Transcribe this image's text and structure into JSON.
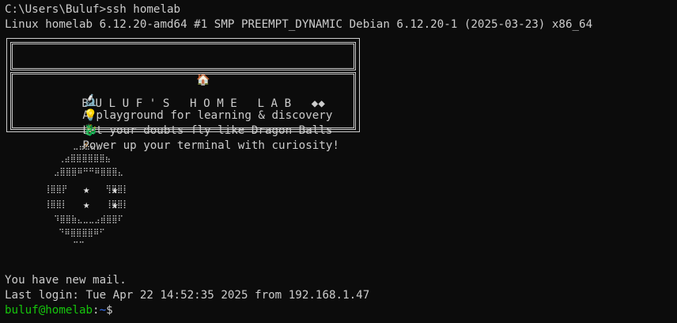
{
  "terminal": {
    "cmd_line": "C:\\Users\\Buluf>ssh homelab",
    "kernel_line": "Linux homelab 6.12.20-amd64 #1 SMP PREEMPT_DYNAMIC Debian 6.12.20-1 (2025-03-23) x86_64",
    "banner": {
      "title_icon": "🏠",
      "title": "B U L U F ' S   H O M E   L A B   ◆◆",
      "lines": [
        {
          "icon": "🔬",
          "text": "A playground for learning & discovery",
          "suffix": ""
        },
        {
          "icon": "💡",
          "text": "Let your doubts fly like Dragon Balls ",
          "suffix": "⚡"
        },
        {
          "icon": "🐉",
          "text": "Power up your terminal with curiosity!",
          "suffix": ""
        }
      ]
    },
    "ascii_art": {
      "rows": [
        "      ⣀⣤⣤⣤⣀",
        "   ⢀⣴⣿⣿⣿⣿⣿⣿⣦",
        "  ⣠⣿⣿⣿⠿⠛⠛⠿⣿⣿⣿⣄",
        "⢸⣿⣿⡟        ⢻⣿⣿⡇",
        "⢸⣿⣿⡇        ⢸⣿⣿⡇",
        "⢸⣿⣿⡇        ⣰⣿⣿⣿",
        " ⠹⣿⣿⣷⣄⣀⣀⣠⣾⣿⣿⠏",
        "   ⠙⠿⣿⣿⣿⣿⠿⠋",
        "      ⠉⠉"
      ],
      "stars": [
        "★",
        "★",
        "★",
        "★"
      ]
    },
    "mail_line": "You have new mail.",
    "last_login": "Last login: Tue Apr 22 14:52:35 2025 from 192.168.1.47",
    "prompt": {
      "user_host": "buluf@homelab",
      "sep": ":",
      "path": "~",
      "symbol": "$"
    }
  },
  "colors": {
    "background": "#0c0c0c",
    "text": "#cccccc",
    "prompt_user": "#16c60c",
    "prompt_path": "#3b78ff",
    "bolt": "#f7a33a"
  }
}
